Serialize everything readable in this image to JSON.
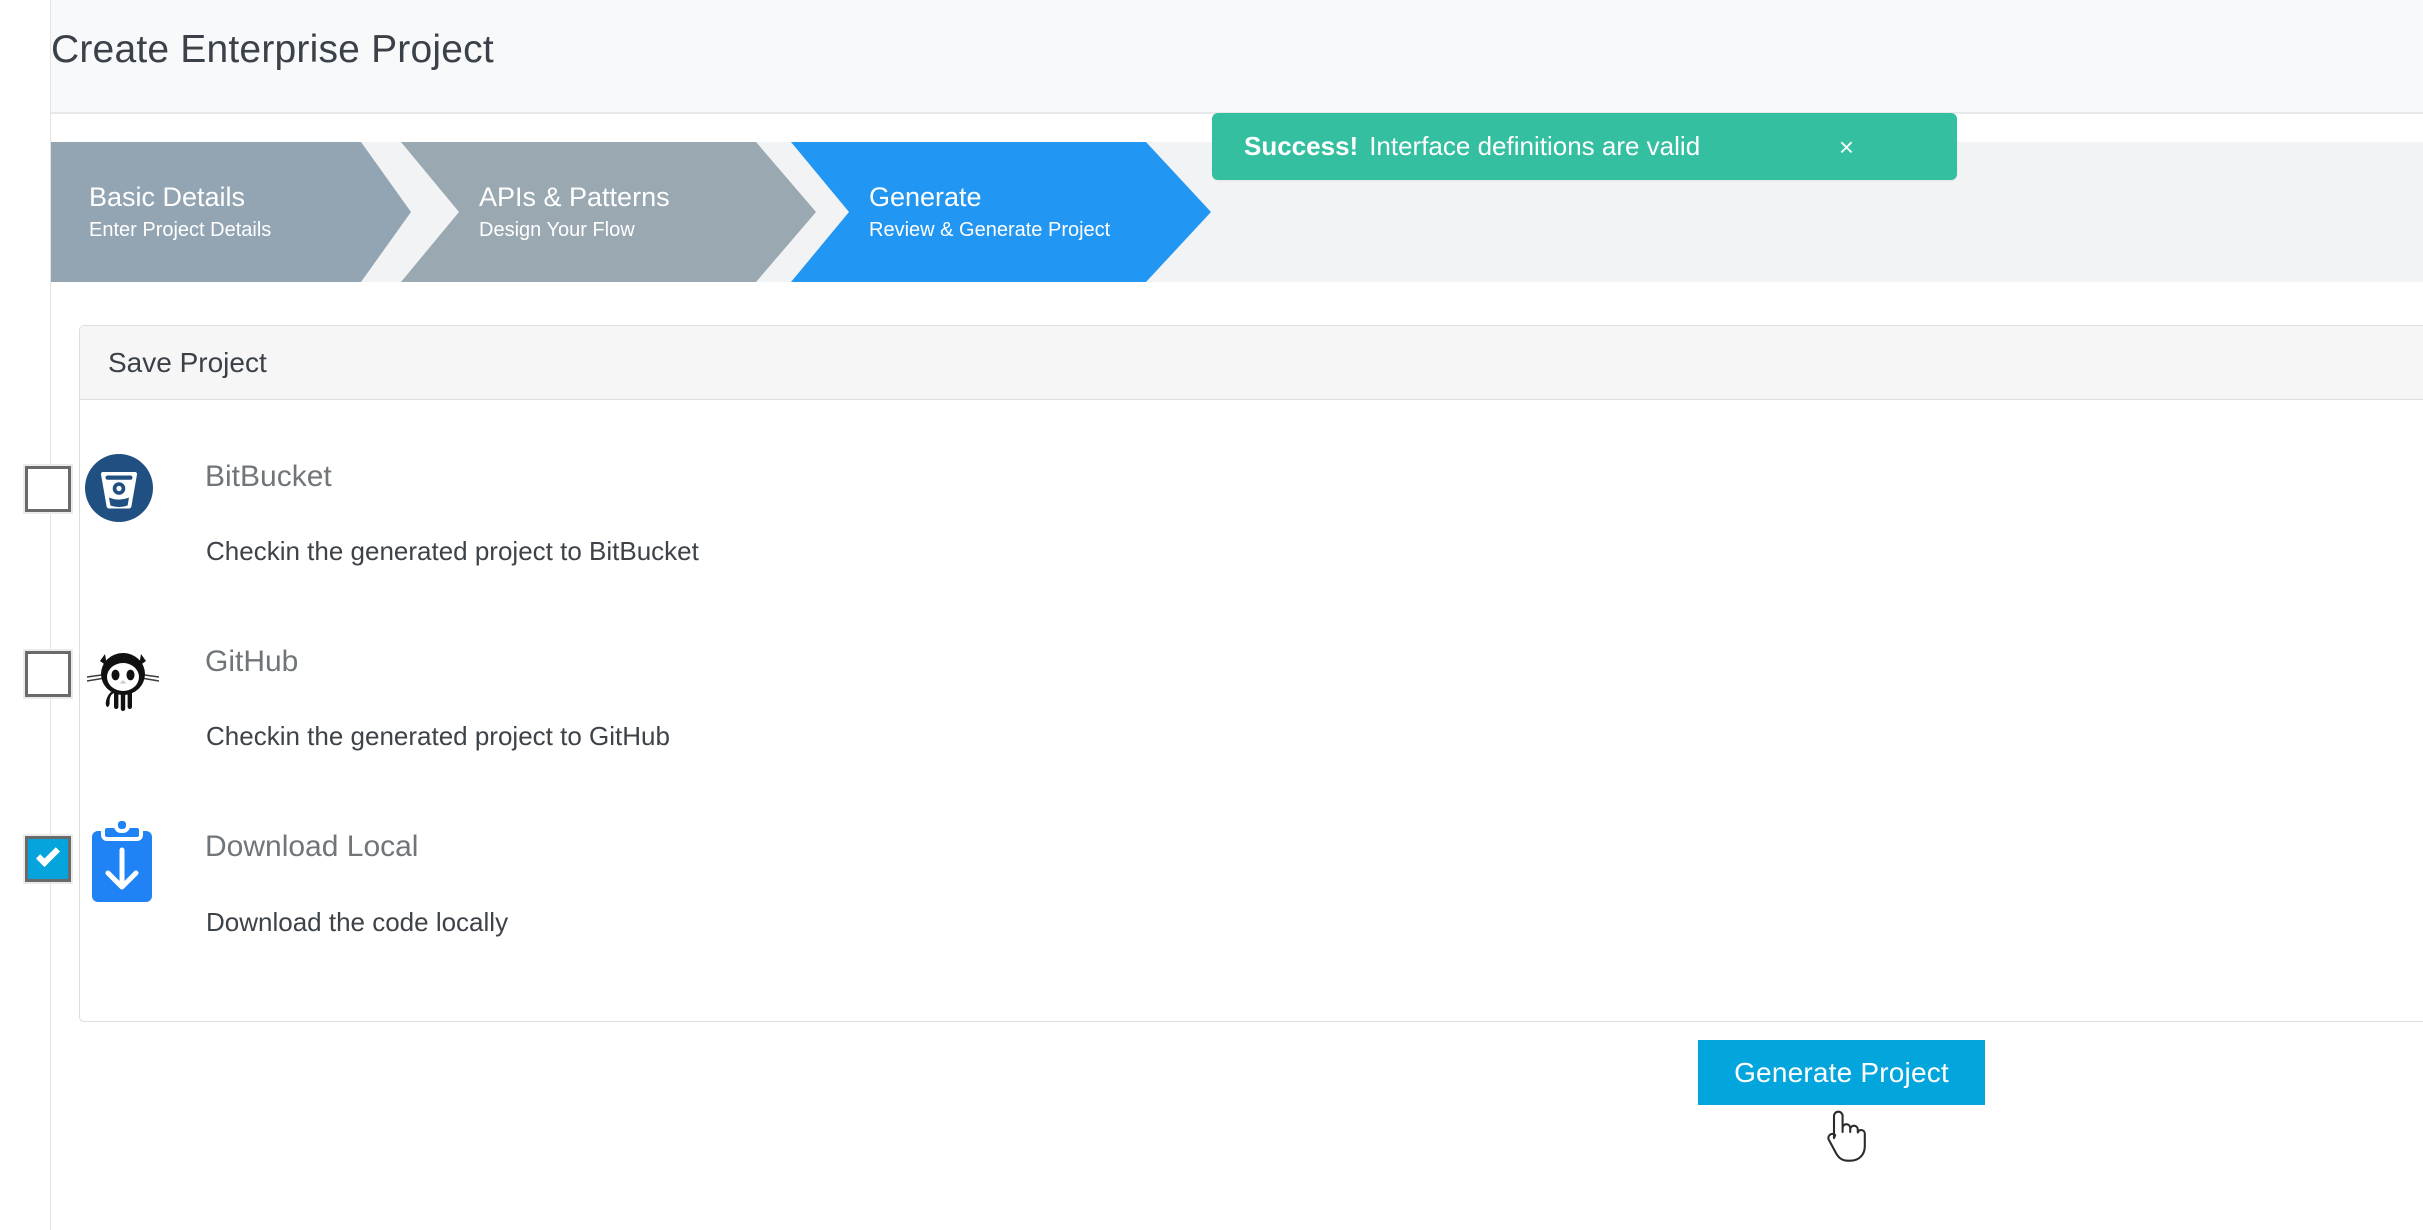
{
  "page": {
    "title": "Create Enterprise Project"
  },
  "wizard": {
    "steps": [
      {
        "title": "Basic Details",
        "subtitle": "Enter Project Details",
        "state": "completed"
      },
      {
        "title": "APIs & Patterns",
        "subtitle": "Design Your Flow",
        "state": "completed"
      },
      {
        "title": "Generate",
        "subtitle": "Review & Generate Project",
        "state": "active"
      }
    ],
    "active_color": "#2196f3",
    "inactive_color": "#93a5b2"
  },
  "alert": {
    "strong": "Success!",
    "message": "Interface definitions are valid",
    "close_label": "×",
    "color": "#33bfa0"
  },
  "panel": {
    "heading": "Save Project",
    "options": [
      {
        "name": "BitBucket",
        "description": "Checkin the generated project to BitBucket",
        "checked": false,
        "icon": "bitbucket-icon",
        "icon_color": "#205081"
      },
      {
        "name": "GitHub",
        "description": "Checkin the generated project to GitHub",
        "checked": false,
        "icon": "github-octocat-icon",
        "icon_color": "#000000"
      },
      {
        "name": "Download Local",
        "description": "Download the code locally",
        "checked": true,
        "icon": "clipboard-download-icon",
        "icon_color": "#1f83f5"
      }
    ]
  },
  "actions": {
    "generate_label": "Generate Project",
    "generate_color": "#03a5dd"
  },
  "cursor": {
    "type": "pointing-hand-cursor"
  }
}
